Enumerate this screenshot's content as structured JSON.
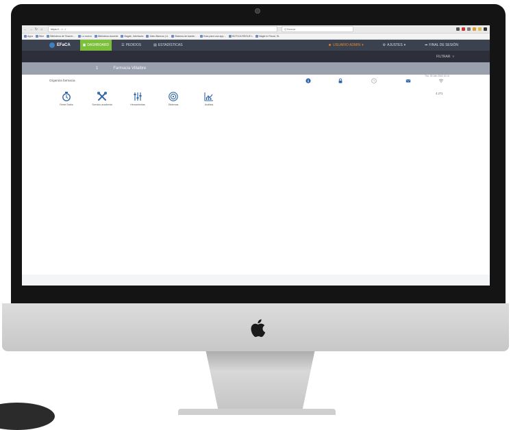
{
  "browser": {
    "url": "https://…/…/",
    "search_placeholder": "Q  Buscar",
    "bookmarks": [
      "Apps",
      "Bice",
      "Biblioteca de Tesorer…",
      "Lo nuevo",
      "Biblioteca docente",
      "Bagde, interfaces",
      "Zabu Bancos | U.",
      "Sistema de bande…",
      "Guia para una app…",
      "BOTICA REGUE L",
      "Nagle in Fiscal, SL"
    ]
  },
  "app": {
    "logo": "EFaCA",
    "nav": {
      "dashboard": "DASHBOARD",
      "pedidos": "PEDIDOS",
      "estadisticas": "ESTADÍSTICAS",
      "user": "USUARIO ADMIN",
      "settings": "AJUSTES",
      "logout": "FINAL DE SESIÓN"
    },
    "filter_label": "FILTRAR"
  },
  "pharmacy": {
    "index": "1",
    "name": "Farmacia Villalbre"
  },
  "content": {
    "section_title": "Organiza farmacia",
    "timestamp": "Thu, 30 Jan 2018 10:14",
    "signal_value": "4.271",
    "tools": [
      {
        "label": "Reset Tasks",
        "icon": "clock-icon"
      },
      {
        "label": "Servicio academia",
        "icon": "tools-icon"
      },
      {
        "label": "Herramientas",
        "icon": "sliders-icon"
      },
      {
        "label": "Sistemas",
        "icon": "target-icon"
      },
      {
        "label": "Análisis",
        "icon": "chart-icon"
      }
    ]
  },
  "colors": {
    "nav_bg": "#3c4150",
    "action_bar_bg": "#2c2f3a",
    "pharmacy_bar_bg": "#9aa0ae",
    "active_green": "#7cbf3a",
    "user_orange": "#e08b2a",
    "icon_blue": "#2f66a8"
  }
}
